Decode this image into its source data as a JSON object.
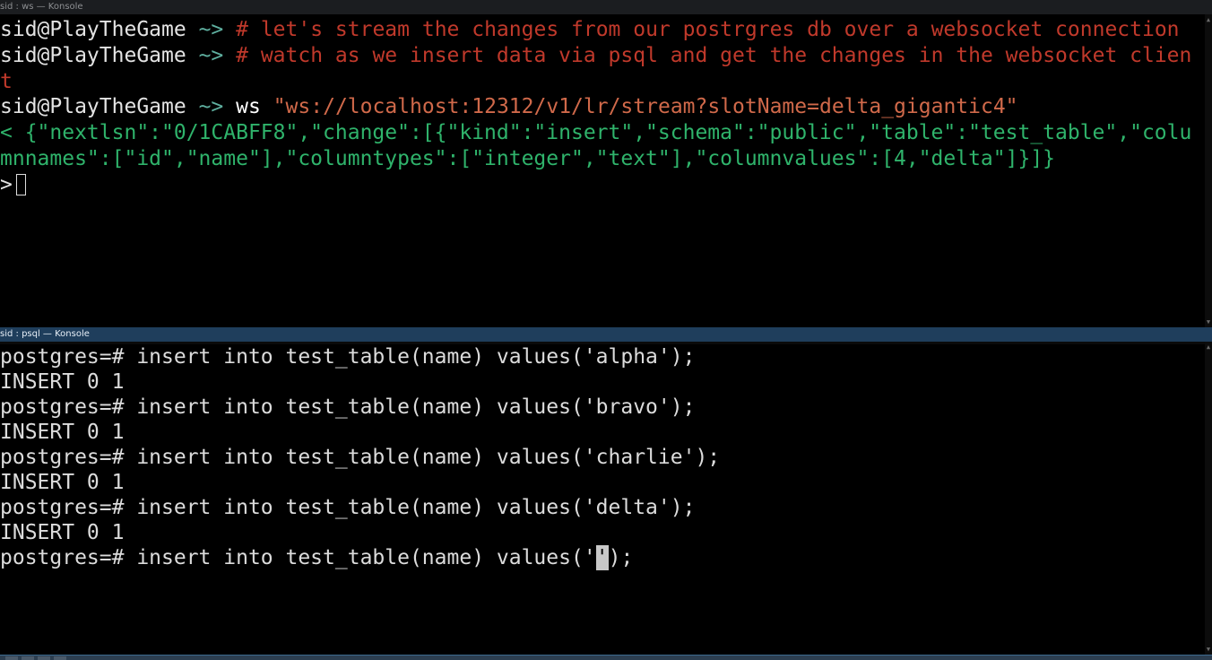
{
  "windows": {
    "top": {
      "title": "sid : ws — Konsole",
      "lines": [
        {
          "user": "sid@PlayTheGame",
          "arrow": "~>",
          "comment": "# let's stream the changes from our postrgres db over a websocket connection"
        },
        {
          "user": "sid@PlayTheGame",
          "arrow": "~>",
          "comment": "# watch as we insert data via psql and get the changes in the websocket clien"
        },
        {
          "wrap": "t"
        },
        {
          "user": "sid@PlayTheGame",
          "arrow": "~>",
          "cmd": "ws",
          "arg": "\"ws://localhost:12312/v1/lr/stream?slotName=delta_gigantic4\""
        },
        {
          "json": "< {\"nextlsn\":\"0/1CABFF8\",\"change\":[{\"kind\":\"insert\",\"schema\":\"public\",\"table\":\"test_table\",\"colu"
        },
        {
          "json": "mnnames\":[\"id\",\"name\"],\"columntypes\":[\"integer\",\"text\"],\"columnvalues\":[4,\"delta\"]}]}"
        },
        {
          "prompt": ">"
        }
      ]
    },
    "bottom": {
      "title": "sid : psql — Konsole",
      "lines": [
        "postgres=# insert into test_table(name) values('alpha');",
        "INSERT 0 1",
        "postgres=# insert into test_table(name) values('bravo');",
        "INSERT 0 1",
        "postgres=# insert into test_table(name) values('charlie');",
        "INSERT 0 1",
        "postgres=# insert into test_table(name) values('delta');",
        "INSERT 0 1"
      ],
      "current_input": {
        "before_cursor": "postgres=# insert into test_table(name) values('",
        "cursor_char": "'",
        "after_cursor": ");"
      }
    }
  },
  "colors": {
    "comment": "#c0392b",
    "json": "#2fb36b",
    "string": "#d0694a",
    "arrow": "#5fb0a0",
    "active_title": "#1f3e5c"
  }
}
